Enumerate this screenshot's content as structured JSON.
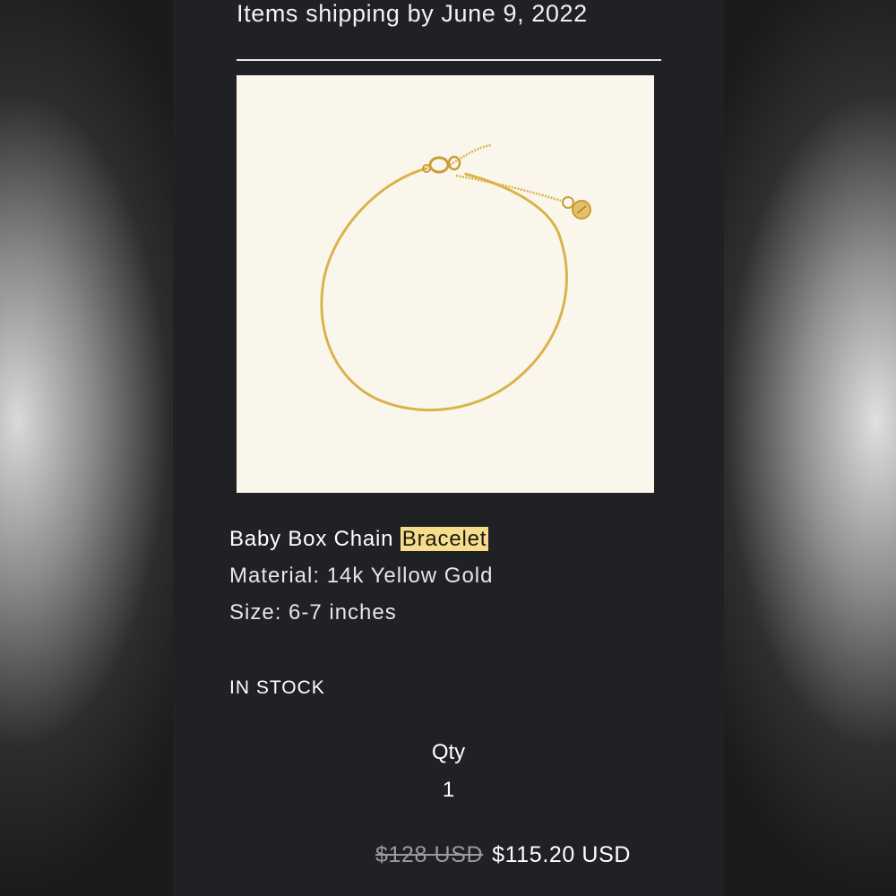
{
  "shipping": {
    "text": "Items shipping by June 9, 2022"
  },
  "product": {
    "name_prefix": "Baby Box Chain ",
    "name_highlight": "Bracelet",
    "material": "Material: 14k Yellow Gold",
    "size": "Size: 6-7 inches",
    "stock_status": "IN STOCK",
    "image_icon": "gold-box-chain-bracelet"
  },
  "quantity": {
    "label": "Qty",
    "value": "1"
  },
  "pricing": {
    "original_price": "$128 USD",
    "sale_price": "$115.20 USD"
  },
  "colors": {
    "panel_background": "#202124",
    "image_background": "#fbf6ec",
    "highlight": "#f7dd8a",
    "gold": "#d9b24a"
  }
}
